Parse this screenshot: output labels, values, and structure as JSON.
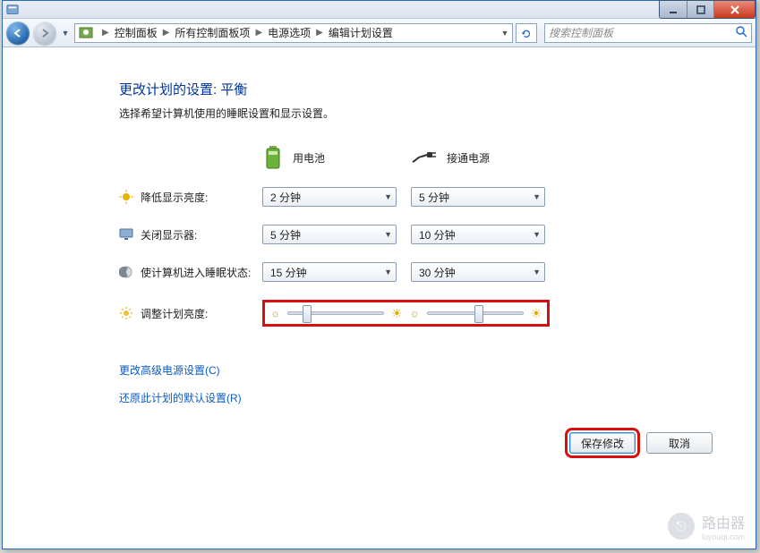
{
  "titlebar": {
    "text": ""
  },
  "nav": {
    "crumbs": [
      "控制面板",
      "所有控制面板项",
      "电源选项",
      "编辑计划设置"
    ],
    "search_placeholder": "搜索控制面板"
  },
  "page": {
    "heading": "更改计划的设置: 平衡",
    "subtitle": "选择希望计算机使用的睡眠设置和显示设置。",
    "col_battery": "用电池",
    "col_ac": "接通电源",
    "rows": {
      "dim": {
        "label": "降低显示亮度:",
        "battery": "2 分钟",
        "ac": "5 分钟"
      },
      "off": {
        "label": "关闭显示器:",
        "battery": "5 分钟",
        "ac": "10 分钟"
      },
      "sleep": {
        "label": "使计算机进入睡眠状态:",
        "battery": "15 分钟",
        "ac": "30 分钟"
      },
      "bright": {
        "label": "调整计划亮度:"
      }
    },
    "links": {
      "advanced": "更改高级电源设置(C)",
      "restore": "还原此计划的默认设置(R)"
    },
    "buttons": {
      "save": "保存修改",
      "cancel": "取消"
    }
  },
  "watermark": {
    "brand": "路由器",
    "domain": "luyouqi.com"
  }
}
